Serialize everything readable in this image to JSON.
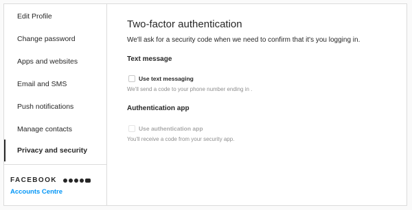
{
  "sidebar": {
    "items": [
      {
        "label": "Edit Profile"
      },
      {
        "label": "Change password"
      },
      {
        "label": "Apps and websites"
      },
      {
        "label": "Email and SMS"
      },
      {
        "label": "Push notifications"
      },
      {
        "label": "Manage contacts"
      },
      {
        "label": "Privacy and security"
      }
    ],
    "active_item": "Privacy and security",
    "facebook": {
      "brand": "FACEBOOK",
      "icons": [
        "facebook-icon",
        "messenger-icon",
        "instagram-icon",
        "whatsapp-icon",
        "portal-icon"
      ],
      "link": "Accounts Centre"
    }
  },
  "main": {
    "title": "Two-factor authentication",
    "description": "We'll ask for a security code when we need to confirm that it's you logging in.",
    "text_message": {
      "heading": "Text message",
      "option_label": "Use text messaging",
      "checked": false,
      "helper": "We'll send a code to your phone number ending in ."
    },
    "auth_app": {
      "heading": "Authentication app",
      "option_label": "Use authentication app",
      "checked": false,
      "disabled": true,
      "helper": "You'll receive a code from your security app."
    }
  },
  "colors": {
    "accent": "#0095f6",
    "text": "#262626",
    "muted": "#8e8e8e",
    "border": "#dbdbdb",
    "disabled": "#a8a8a8"
  }
}
